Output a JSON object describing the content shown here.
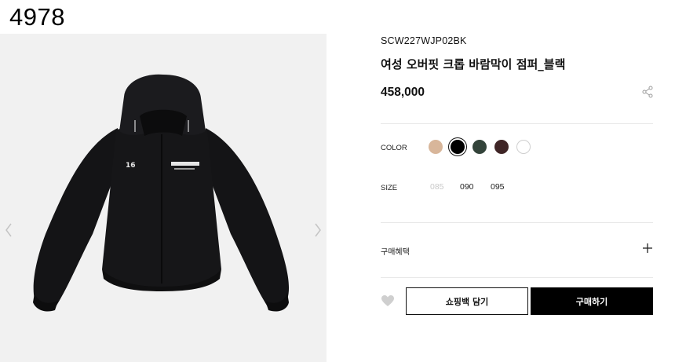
{
  "page_number": "4978",
  "product": {
    "sku": "SCW227WJP02BK",
    "title": "여성 오버핏 크롭 바람막이 점퍼_블랙",
    "price": "458,000"
  },
  "options": {
    "color_label": "COLOR",
    "colors": [
      {
        "name": "beige",
        "hex": "#d8b69a",
        "selected": false
      },
      {
        "name": "black",
        "hex": "#000000",
        "selected": true
      },
      {
        "name": "dark-green",
        "hex": "#33433a",
        "selected": false
      },
      {
        "name": "dark-brown",
        "hex": "#3f2526",
        "selected": false
      },
      {
        "name": "white",
        "hex": "#ffffff",
        "selected": false
      }
    ],
    "size_label": "SIZE",
    "sizes": [
      {
        "value": "085",
        "available": false
      },
      {
        "value": "090",
        "available": true
      },
      {
        "value": "095",
        "available": true
      }
    ]
  },
  "benefits": {
    "label": "구매혜택"
  },
  "actions": {
    "cart_label": "쇼핑백 담기",
    "buy_label": "구매하기"
  },
  "icons": {
    "share": "share-icon",
    "plus": "plus-icon",
    "heart": "heart-icon",
    "prev": "chevron-left-icon",
    "next": "chevron-right-icon"
  }
}
